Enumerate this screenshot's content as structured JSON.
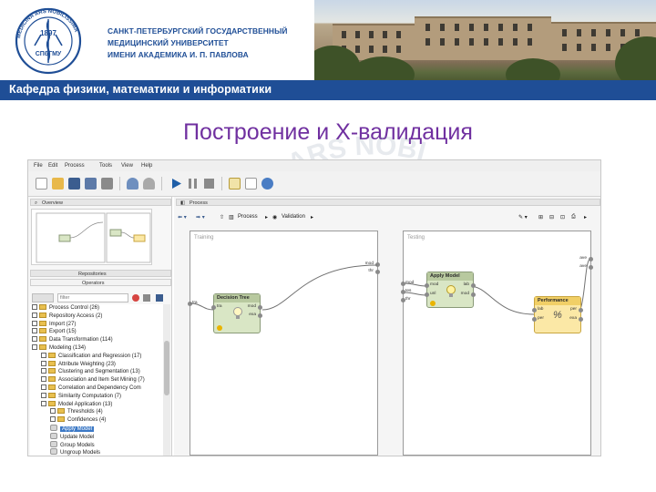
{
  "header": {
    "university_lines": [
      "САНКТ-ПЕТЕРБУРГСКИЙ ГОСУДАРСТВЕННЫЙ",
      "МЕДИЦИНСКИЙ УНИВЕРСИТЕТ",
      "ИМЕНИ АКАДЕМИКА И. П. ПАВЛОВА"
    ],
    "department": "Кафедра физики,  математики и информатики",
    "logo_text": {
      "top": "MEDICINA ARS NOBILISSIMA",
      "year": "1897",
      "abbr": "СПбГМУ"
    },
    "brand_color": "#1f4e96"
  },
  "slide": {
    "title": "Построение и Х-валидация",
    "title_color": "#7030a0",
    "watermark": "ARS NOBI"
  },
  "app": {
    "menu": [
      "File",
      "Edit",
      "Process",
      "Tools",
      "View",
      "Help"
    ],
    "toolbar_icons": [
      "new-icon",
      "open-icon",
      "save-icon",
      "save-as-icon",
      "export-icon",
      "undo-icon",
      "redo-icon",
      "run-icon",
      "pause-icon",
      "stop-icon",
      "wizard-icon",
      "validate-icon",
      "info-icon"
    ],
    "left_tabs": {
      "overview": "Overview",
      "repositories": "Repositories",
      "operators": "Operators"
    },
    "operators_search_placeholder": "filter",
    "operator_tree": [
      {
        "label": "Process Control (26)",
        "level": 0,
        "type": "folder"
      },
      {
        "label": "Repository Access (2)",
        "level": 0,
        "type": "folder"
      },
      {
        "label": "Import (27)",
        "level": 0,
        "type": "folder"
      },
      {
        "label": "Export (15)",
        "level": 0,
        "type": "folder"
      },
      {
        "label": "Data Transformation (114)",
        "level": 0,
        "type": "folder"
      },
      {
        "label": "Modeling (134)",
        "level": 0,
        "type": "folder"
      },
      {
        "label": "Classification and Regression (17)",
        "level": 1,
        "type": "folder"
      },
      {
        "label": "Attribute Weighting (23)",
        "level": 1,
        "type": "folder"
      },
      {
        "label": "Clustering and Segmentation (13)",
        "level": 1,
        "type": "folder"
      },
      {
        "label": "Association and Item Set Mining (7)",
        "level": 1,
        "type": "folder"
      },
      {
        "label": "Correlation and Dependency Com",
        "level": 1,
        "type": "folder"
      },
      {
        "label": "Similarity Computation (7)",
        "level": 1,
        "type": "folder"
      },
      {
        "label": "Model Application (13)",
        "level": 1,
        "type": "folder"
      },
      {
        "label": "Thresholds (4)",
        "level": 2,
        "type": "folder"
      },
      {
        "label": "Confidences (4)",
        "level": 2,
        "type": "folder"
      },
      {
        "label": "Apply Model",
        "level": 2,
        "type": "operator",
        "selected": true
      },
      {
        "label": "Update Model",
        "level": 2,
        "type": "operator"
      },
      {
        "label": "Group Models",
        "level": 2,
        "type": "operator"
      },
      {
        "label": "Ungroup Models",
        "level": 2,
        "type": "operator"
      }
    ],
    "process_tab": "Process",
    "breadcrumb": [
      "Process",
      "Validation"
    ],
    "subprocesses": {
      "training": {
        "title": "Training",
        "operator": "Decision Tree",
        "in_ports": [
          "tra"
        ],
        "out_ports": [
          "mod",
          "exa"
        ]
      },
      "testing": {
        "title": "Testing",
        "apply_model": "Apply Model",
        "apply_in_ports": [
          "mod",
          "unl"
        ],
        "apply_out_ports": [
          "lab",
          "mod"
        ],
        "performance": "Performance",
        "perf_in_ports": [
          "lab",
          "per"
        ],
        "perf_out_ports": [
          "per",
          "exa"
        ]
      },
      "edge_port_labels": {
        "training_out": [
          "mod",
          "thr"
        ],
        "testing_in": [
          "mod",
          "tes",
          "thr"
        ],
        "testing_out": [
          "ave",
          "ave"
        ],
        "training_in": "tra"
      }
    }
  }
}
